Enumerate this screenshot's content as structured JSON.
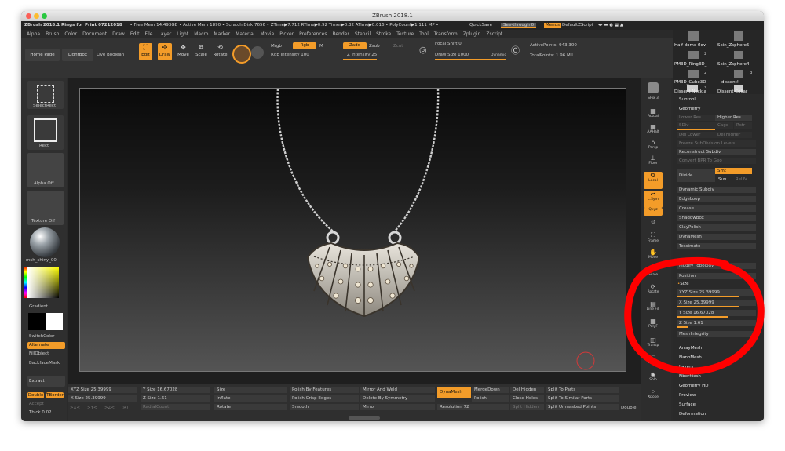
{
  "window": {
    "title": "ZBrush 2018.1"
  },
  "infobar": {
    "app": "ZBrush 2018.1 Rings for Print 07212018",
    "stats": "• Free Mem 14.493GB • Active Mem 1890 • Scratch Disk 7656 • ZTime▶7.712 RTime▶0.92 Timer▶0.32 ATime▶0.016 • PolyCount▶1.111 MP •",
    "quicksave": "QuickSave",
    "see_through": "See-through  0",
    "menus": "Menus",
    "default_zscript": "DefaultZScript"
  },
  "menubar": [
    "Alpha",
    "Brush",
    "Color",
    "Document",
    "Draw",
    "Edit",
    "File",
    "Layer",
    "Light",
    "Macro",
    "Marker",
    "Material",
    "Movie",
    "Picker",
    "Preferences",
    "Render",
    "Stencil",
    "Stroke",
    "Texture",
    "Tool",
    "Transform",
    "Zplugin",
    "Zscript"
  ],
  "shelf": {
    "home_page": "Home Page",
    "lightbox": "LightBox",
    "live_boolean": "Live Boolean",
    "edit": "Edit",
    "draw": "Draw",
    "move": "Move",
    "scale": "Scale",
    "rotate": "Rotate",
    "mrgb": "Mrgb",
    "rgb": "Rgb",
    "m": "M",
    "rgb_intensity_label": "Rgb Intensity",
    "rgb_intensity": "100",
    "zadd": "Zadd",
    "zsub": "Zsub",
    "zcut": "Zcut",
    "z_intensity_label": "Z Intensity",
    "z_intensity": "25",
    "focal_shift_label": "Focal Shift",
    "focal_shift": "0",
    "draw_size_label": "Draw Size",
    "draw_size": "1000",
    "dynamic": "Dynamic",
    "active_points_label": "ActivePoints:",
    "active_points": "943,300",
    "total_points_label": "TotalPoints:",
    "total_points": "1.96 Mil"
  },
  "left_tray": {
    "select_rect": "SelectRect",
    "rect": "Rect",
    "alpha_off": "Alpha Off",
    "texture_off": "Texture Off",
    "material": "msh_shiny_00",
    "gradient": "Gradient",
    "switch_color": "SwitchColor",
    "alternate": "Alternate",
    "fill_object": "FillObject",
    "backface_mask": "BackfaceMask",
    "extract": "Extract",
    "double": "Double",
    "tborder": "TBorder",
    "accept": "Accept",
    "thick_label": "Thick",
    "thick": "0.02"
  },
  "right_tray": [
    "SPix 3",
    "Actual",
    "AAHalf",
    "Persp",
    "Floor",
    "Local",
    "L.Sym",
    "Qxyz",
    "Frame",
    "Move",
    "Scale",
    "Rotate",
    "Line Fill",
    "PolyF",
    "Transp",
    "Ghost",
    "Solo",
    "Xpose"
  ],
  "subtool_list": {
    "items": [
      "Half-dome flov",
      "Skin_Zsphere5",
      "PM3D_Ring3D_",
      "Skin_Zsphere4",
      "PM3D_Cube3D",
      "dissent!",
      "Dissent Neckla",
      "Dissent Collar"
    ],
    "counts": [
      "2",
      "2",
      "3",
      "3"
    ]
  },
  "panel": {
    "subtool": "Subtool",
    "geometry": "Geometry",
    "lower_res": "Lower Res",
    "higher_res": "Higher Res",
    "sdiv": "SDiv",
    "cage": "Cage",
    "rstr": "Rstr",
    "del_lower": "Del Lower",
    "del_higher": "Del Higher",
    "freeze": "Freeze SubDivision Levels",
    "reconstruct": "Reconstruct Subdiv",
    "convert_bpr": "Convert BPR To Geo",
    "divide": "Divide",
    "smt": "Smt",
    "suv": "Suv",
    "reuv": "ReUV",
    "dynamic_subdiv": "Dynamic Subdiv",
    "edgeloop": "EdgeLoop",
    "crease": "Crease",
    "shadowbox": "ShadowBox",
    "claypolish": "ClayPolish",
    "dynamesh": "DynaMesh",
    "tessimate": "Tessimate",
    "modify_topology": "Modify Topology",
    "position": "Position",
    "size": "Size",
    "xyz_size": "XYZ Size 25.39999",
    "x_size": "X Size 25.39999",
    "y_size": "Y Size 16.67028",
    "z_size": "Z Size 1.61",
    "meshintegrity": "MeshIntegrity",
    "arraymesh": "ArrayMesh",
    "nanomesh": "NanoMesh",
    "layers": "Layers",
    "fibermesh": "FiberMesh",
    "geometry_hd": "Geometry HD",
    "preview": "Preview",
    "surface": "Surface",
    "deformation": "Deformation"
  },
  "bottom": {
    "xyz_size": "XYZ Size 25.39999",
    "x_size": "X Size 25.39999",
    "y_size": "Y Size 16.67028",
    "z_size": "Z Size 1.61",
    "radialcount": "RadialCount",
    "size": "Size",
    "inflate": "Inflate",
    "rotate": "Rotate",
    "polish_by_features": "Polish By Features",
    "polish_crisp_edges": "Polish Crisp Edges",
    "smooth": "Smooth",
    "mirror_and_weld": "Mirror And Weld",
    "delete_by_symmetry": "Delete By Symmetry",
    "mirror": "Mirror",
    "dynamesh": "DynaMesh",
    "mergedown": "MergeDown",
    "polish": "Polish",
    "resolution_label": "Resolution",
    "resolution": "72",
    "del_hidden": "Del Hidden",
    "close_holes": "Close Holes",
    "split_hidden": "Split Hidden",
    "split_to_parts": "Split To Parts",
    "split_to_similar": "Split To Similar Parts",
    "split_unmasked": "Split Unmasked Points",
    "double": "Double",
    "gx": ">X<",
    "gy": ">Y<",
    "gz": ">Z<",
    "gr": "(R)"
  },
  "colors": {
    "accent": "#f39c29",
    "annotation": "#ff0000"
  }
}
